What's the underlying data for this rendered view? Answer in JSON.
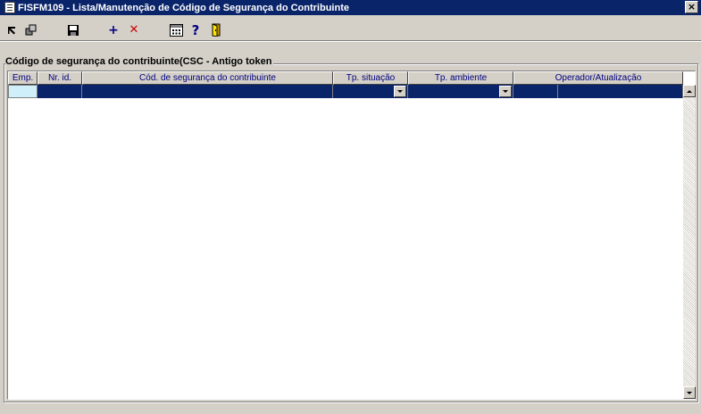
{
  "window": {
    "title": "FISFM109 - Lista/Manutenção de Código de Segurança do Contribuinte",
    "close_label": "×",
    "title_bar_color": "#0a246a"
  },
  "toolbar": {
    "items": [
      {
        "name": "first-record-icon"
      },
      {
        "name": "copy-records-icon"
      },
      {
        "name": "save-icon"
      },
      {
        "name": "add-icon",
        "glyph": "+",
        "color": "#00007f"
      },
      {
        "name": "delete-icon",
        "glyph": "✕",
        "color": "#cc0000"
      },
      {
        "name": "calendar-icon"
      },
      {
        "name": "help-icon",
        "glyph": "?",
        "color": "#00007f"
      },
      {
        "name": "exit-door-icon"
      }
    ]
  },
  "group": {
    "label": "Código de segurança do contribuinte(CSC - Antigo token"
  },
  "grid": {
    "columns": [
      {
        "key": "emp",
        "label": "Emp."
      },
      {
        "key": "nr_id",
        "label": "Nr. id."
      },
      {
        "key": "csc",
        "label": "Cód. de segurança do contribuinte"
      },
      {
        "key": "tp_situacao",
        "label": "Tp. situação"
      },
      {
        "key": "tp_ambiente",
        "label": "Tp. ambiente"
      },
      {
        "key": "operador",
        "label": "Operador/Atualização"
      }
    ],
    "rows": [
      {
        "emp": "",
        "nr_id": "",
        "csc": "",
        "tp_situacao": "",
        "tp_ambiente": "",
        "operador": "",
        "atualizacao": ""
      }
    ],
    "selection_color": "#0a246a",
    "active_cell_color": "#cfeffb"
  }
}
